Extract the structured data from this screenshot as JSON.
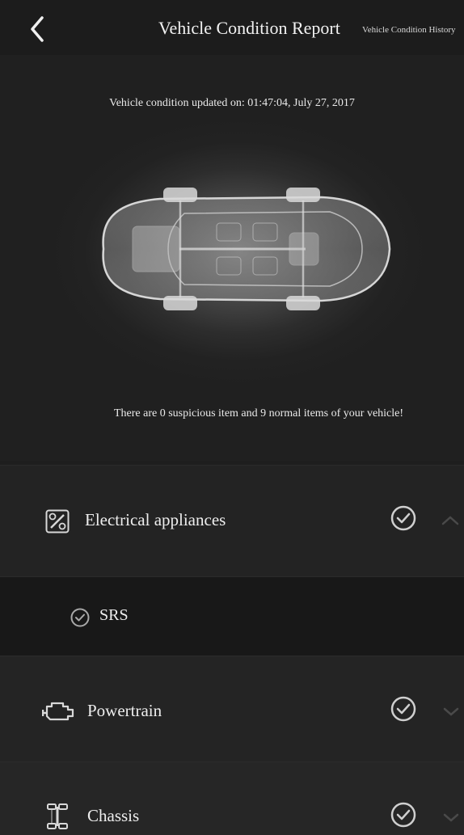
{
  "header": {
    "title": "Vehicle Condition Report",
    "history_link": "Vehicle Condition History",
    "back_icon": "chevron-left-icon"
  },
  "hero": {
    "updated_text": "Vehicle condition updated on: 01:47:04, July 27, 2017",
    "summary_text": "There are 0 suspicious item and 9 normal items of your vehicle!",
    "suspicious_count": 0,
    "normal_count": 9
  },
  "sections": [
    {
      "label": "Electrical appliances",
      "icon": "electrical-icon",
      "status": "normal",
      "expanded": true
    },
    {
      "label": "SRS",
      "icon": "check-circle-icon",
      "status": "normal",
      "subitem": true
    },
    {
      "label": "Powertrain",
      "icon": "engine-icon",
      "status": "normal",
      "expanded": false
    },
    {
      "label": "Chassis",
      "icon": "chassis-icon",
      "status": "normal",
      "expanded": false
    }
  ],
  "colors": {
    "background": "#1b1b1b",
    "text": "#eeeeee",
    "check": "#cfcfcf"
  }
}
